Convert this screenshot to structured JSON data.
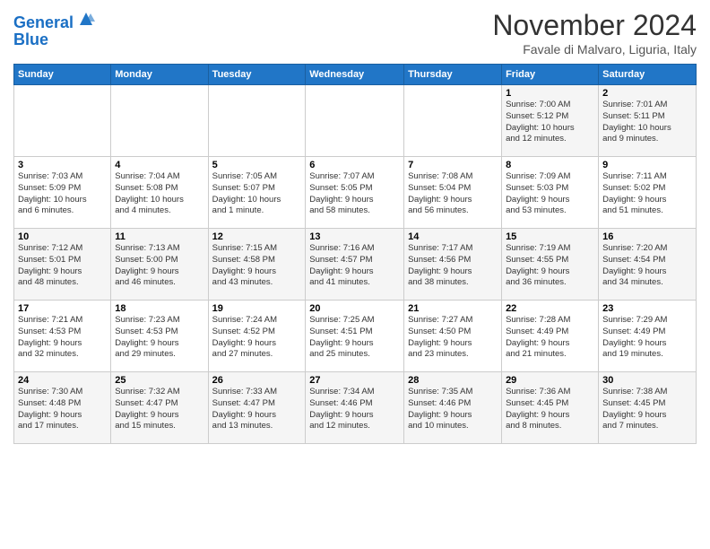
{
  "header": {
    "logo_line1": "General",
    "logo_line2": "Blue",
    "month_title": "November 2024",
    "subtitle": "Favale di Malvaro, Liguria, Italy"
  },
  "weekdays": [
    "Sunday",
    "Monday",
    "Tuesday",
    "Wednesday",
    "Thursday",
    "Friday",
    "Saturday"
  ],
  "weeks": [
    [
      {
        "day": "",
        "info": ""
      },
      {
        "day": "",
        "info": ""
      },
      {
        "day": "",
        "info": ""
      },
      {
        "day": "",
        "info": ""
      },
      {
        "day": "",
        "info": ""
      },
      {
        "day": "1",
        "info": "Sunrise: 7:00 AM\nSunset: 5:12 PM\nDaylight: 10 hours\nand 12 minutes."
      },
      {
        "day": "2",
        "info": "Sunrise: 7:01 AM\nSunset: 5:11 PM\nDaylight: 10 hours\nand 9 minutes."
      }
    ],
    [
      {
        "day": "3",
        "info": "Sunrise: 7:03 AM\nSunset: 5:09 PM\nDaylight: 10 hours\nand 6 minutes."
      },
      {
        "day": "4",
        "info": "Sunrise: 7:04 AM\nSunset: 5:08 PM\nDaylight: 10 hours\nand 4 minutes."
      },
      {
        "day": "5",
        "info": "Sunrise: 7:05 AM\nSunset: 5:07 PM\nDaylight: 10 hours\nand 1 minute."
      },
      {
        "day": "6",
        "info": "Sunrise: 7:07 AM\nSunset: 5:05 PM\nDaylight: 9 hours\nand 58 minutes."
      },
      {
        "day": "7",
        "info": "Sunrise: 7:08 AM\nSunset: 5:04 PM\nDaylight: 9 hours\nand 56 minutes."
      },
      {
        "day": "8",
        "info": "Sunrise: 7:09 AM\nSunset: 5:03 PM\nDaylight: 9 hours\nand 53 minutes."
      },
      {
        "day": "9",
        "info": "Sunrise: 7:11 AM\nSunset: 5:02 PM\nDaylight: 9 hours\nand 51 minutes."
      }
    ],
    [
      {
        "day": "10",
        "info": "Sunrise: 7:12 AM\nSunset: 5:01 PM\nDaylight: 9 hours\nand 48 minutes."
      },
      {
        "day": "11",
        "info": "Sunrise: 7:13 AM\nSunset: 5:00 PM\nDaylight: 9 hours\nand 46 minutes."
      },
      {
        "day": "12",
        "info": "Sunrise: 7:15 AM\nSunset: 4:58 PM\nDaylight: 9 hours\nand 43 minutes."
      },
      {
        "day": "13",
        "info": "Sunrise: 7:16 AM\nSunset: 4:57 PM\nDaylight: 9 hours\nand 41 minutes."
      },
      {
        "day": "14",
        "info": "Sunrise: 7:17 AM\nSunset: 4:56 PM\nDaylight: 9 hours\nand 38 minutes."
      },
      {
        "day": "15",
        "info": "Sunrise: 7:19 AM\nSunset: 4:55 PM\nDaylight: 9 hours\nand 36 minutes."
      },
      {
        "day": "16",
        "info": "Sunrise: 7:20 AM\nSunset: 4:54 PM\nDaylight: 9 hours\nand 34 minutes."
      }
    ],
    [
      {
        "day": "17",
        "info": "Sunrise: 7:21 AM\nSunset: 4:53 PM\nDaylight: 9 hours\nand 32 minutes."
      },
      {
        "day": "18",
        "info": "Sunrise: 7:23 AM\nSunset: 4:53 PM\nDaylight: 9 hours\nand 29 minutes."
      },
      {
        "day": "19",
        "info": "Sunrise: 7:24 AM\nSunset: 4:52 PM\nDaylight: 9 hours\nand 27 minutes."
      },
      {
        "day": "20",
        "info": "Sunrise: 7:25 AM\nSunset: 4:51 PM\nDaylight: 9 hours\nand 25 minutes."
      },
      {
        "day": "21",
        "info": "Sunrise: 7:27 AM\nSunset: 4:50 PM\nDaylight: 9 hours\nand 23 minutes."
      },
      {
        "day": "22",
        "info": "Sunrise: 7:28 AM\nSunset: 4:49 PM\nDaylight: 9 hours\nand 21 minutes."
      },
      {
        "day": "23",
        "info": "Sunrise: 7:29 AM\nSunset: 4:49 PM\nDaylight: 9 hours\nand 19 minutes."
      }
    ],
    [
      {
        "day": "24",
        "info": "Sunrise: 7:30 AM\nSunset: 4:48 PM\nDaylight: 9 hours\nand 17 minutes."
      },
      {
        "day": "25",
        "info": "Sunrise: 7:32 AM\nSunset: 4:47 PM\nDaylight: 9 hours\nand 15 minutes."
      },
      {
        "day": "26",
        "info": "Sunrise: 7:33 AM\nSunset: 4:47 PM\nDaylight: 9 hours\nand 13 minutes."
      },
      {
        "day": "27",
        "info": "Sunrise: 7:34 AM\nSunset: 4:46 PM\nDaylight: 9 hours\nand 12 minutes."
      },
      {
        "day": "28",
        "info": "Sunrise: 7:35 AM\nSunset: 4:46 PM\nDaylight: 9 hours\nand 10 minutes."
      },
      {
        "day": "29",
        "info": "Sunrise: 7:36 AM\nSunset: 4:45 PM\nDaylight: 9 hours\nand 8 minutes."
      },
      {
        "day": "30",
        "info": "Sunrise: 7:38 AM\nSunset: 4:45 PM\nDaylight: 9 hours\nand 7 minutes."
      }
    ]
  ]
}
